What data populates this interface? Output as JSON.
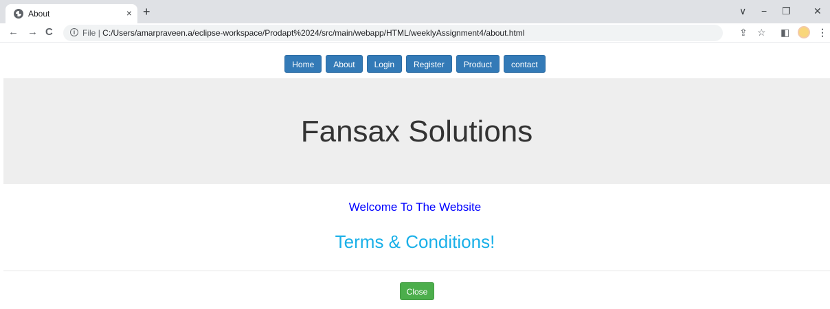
{
  "browser": {
    "tab_title": "About",
    "tab_close": "×",
    "new_tab": "+",
    "back": "←",
    "forward": "→",
    "reload": "C",
    "info": "i",
    "url_scheme": "File",
    "url_separator": "|",
    "url_path": "C:/Users/amarpraveen.a/eclipse-workspace/Prodapt%2024/src/main/webapp/HTML/weeklyAssignment4/about.html",
    "window_controls": {
      "dropdown": "∨",
      "minimize": "−",
      "restore": "❐",
      "close": "✕"
    },
    "toolbar_icons": {
      "share": "⇪",
      "star": "☆",
      "sidepanel": "◧",
      "menu": "⋮"
    }
  },
  "nav": {
    "items": [
      {
        "label": "Home"
      },
      {
        "label": "About"
      },
      {
        "label": "Login"
      },
      {
        "label": "Register"
      },
      {
        "label": "Product"
      },
      {
        "label": "contact"
      }
    ]
  },
  "jumbotron": {
    "title": "Fansax Solutions"
  },
  "content": {
    "welcome": "Welcome To The Website",
    "terms": "Terms & Conditions!"
  },
  "footer": {
    "close_label": "Close"
  },
  "colors": {
    "nav_button": "#337ab7",
    "jumbotron_bg": "#eeeeee",
    "welcome_text": "#0000ff",
    "terms_text": "#1ab0e8",
    "close_button": "#4cae4c"
  }
}
